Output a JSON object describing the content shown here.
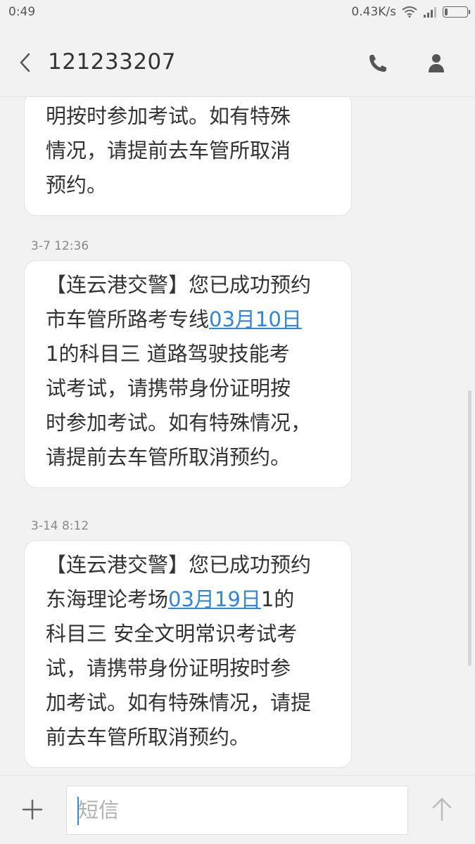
{
  "status_bar": {
    "time": "0:49",
    "network_speed": "0.43K/s"
  },
  "header": {
    "title": "121233207",
    "back_icon": "chevron-left-icon",
    "call_icon": "phone-icon",
    "contact_icon": "person-icon"
  },
  "messages": [
    {
      "lines": [
        "明按时参加考试。如有特殊",
        "情况，请提前去车管所取消",
        "预约。"
      ]
    },
    {
      "timestamp": "3-7 12:36",
      "line1": "【连云港交警】您已成功预约",
      "line2_prefix": "市车管所路考专线",
      "link_date": "03月10日",
      "line3": "1的科目三 道路驾驶技能考",
      "line4": "试考试，请携带身份证明按",
      "line5": "时参加考试。如有特殊情况，",
      "line6": "请提前去车管所取消预约。"
    },
    {
      "timestamp": "3-14 8:12",
      "line1": "【连云港交警】您已成功预约",
      "line2_prefix": "东海理论考场",
      "link_date": "03月19日",
      "line2_suffix": "1的",
      "line3": "科目三 安全文明常识考试考",
      "line4": "试，请携带身份证明按时参",
      "line5": "加考试。如有特殊情况，请提",
      "line6": "前去车管所取消预约。"
    }
  ],
  "composer": {
    "placeholder": "短信",
    "add_icon": "plus-icon",
    "send_icon": "arrow-up-icon"
  },
  "colors": {
    "background": "#f2f2f2",
    "bubble": "#ffffff",
    "link": "#2f86e0",
    "text": "#333333"
  }
}
